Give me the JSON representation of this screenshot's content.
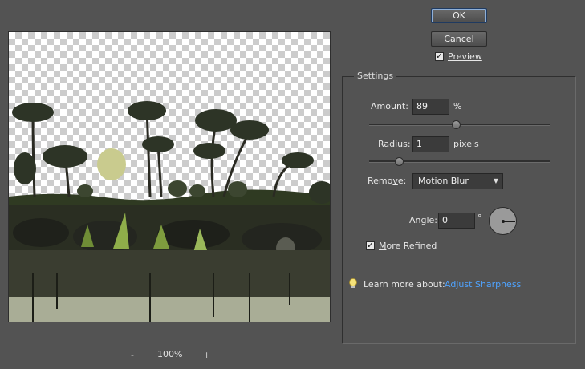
{
  "buttons": {
    "ok": "OK",
    "cancel": "Cancel"
  },
  "preview": {
    "label": "Preview",
    "checked": true
  },
  "zoom": {
    "minus": "-",
    "level": "100%",
    "plus": "+"
  },
  "settings": {
    "title": "Settings",
    "amount": {
      "label": "Amount:",
      "value": "89",
      "unit": "%"
    },
    "radius": {
      "label": "Radius:",
      "value": "1",
      "unit": "pixels"
    },
    "remove": {
      "label_pre": "Remo",
      "label_u": "v",
      "label_post": "e:",
      "selected": "Motion Blur"
    },
    "angle": {
      "label": "Angle:",
      "value": "0",
      "unit": "°"
    },
    "more_refined": {
      "label_u": "M",
      "label_rest": "ore Refined",
      "checked": true
    },
    "learn": {
      "prefix": "Learn more about:",
      "link": "Adjust Sharpness"
    }
  },
  "icons": {
    "check": "✓",
    "caret": "▼",
    "bulb": "lightbulb-icon"
  }
}
